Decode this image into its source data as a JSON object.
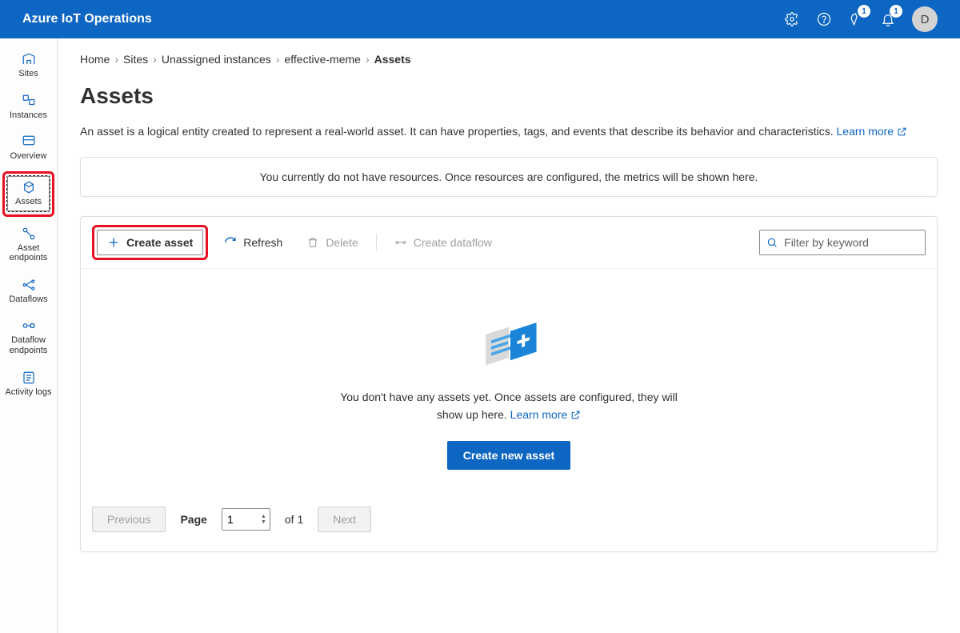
{
  "header": {
    "product": "Azure IoT Operations",
    "badge1": "1",
    "badge2": "1",
    "avatar": "D"
  },
  "sidebar": {
    "items": [
      {
        "label": "Sites"
      },
      {
        "label": "Instances"
      },
      {
        "label": "Overview"
      },
      {
        "label": "Assets"
      },
      {
        "label": "Asset endpoints"
      },
      {
        "label": "Dataflows"
      },
      {
        "label": "Dataflow endpoints"
      },
      {
        "label": "Activity logs"
      }
    ]
  },
  "crumbs": {
    "home": "Home",
    "sites": "Sites",
    "unassigned": "Unassigned instances",
    "instance": "effective-meme",
    "current": "Assets"
  },
  "page": {
    "title": "Assets",
    "desc": "An asset is a logical entity created to represent a real-world asset. It can have properties, tags, and events that describe its behavior and characteristics. ",
    "learn": "Learn more",
    "notice": "You currently do not have resources. Once resources are configured, the metrics will be shown here."
  },
  "toolbar": {
    "create": "Create asset",
    "refresh": "Refresh",
    "delete": "Delete",
    "flow": "Create dataflow",
    "filter_placeholder": "Filter by keyword"
  },
  "empty": {
    "msg1": "You don't have any assets yet. Once assets are configured, they will show up here. ",
    "learn": "Learn more",
    "cta": "Create new asset"
  },
  "pager": {
    "prev": "Previous",
    "page": "Page",
    "value": "1",
    "of": "of 1",
    "next": "Next"
  }
}
